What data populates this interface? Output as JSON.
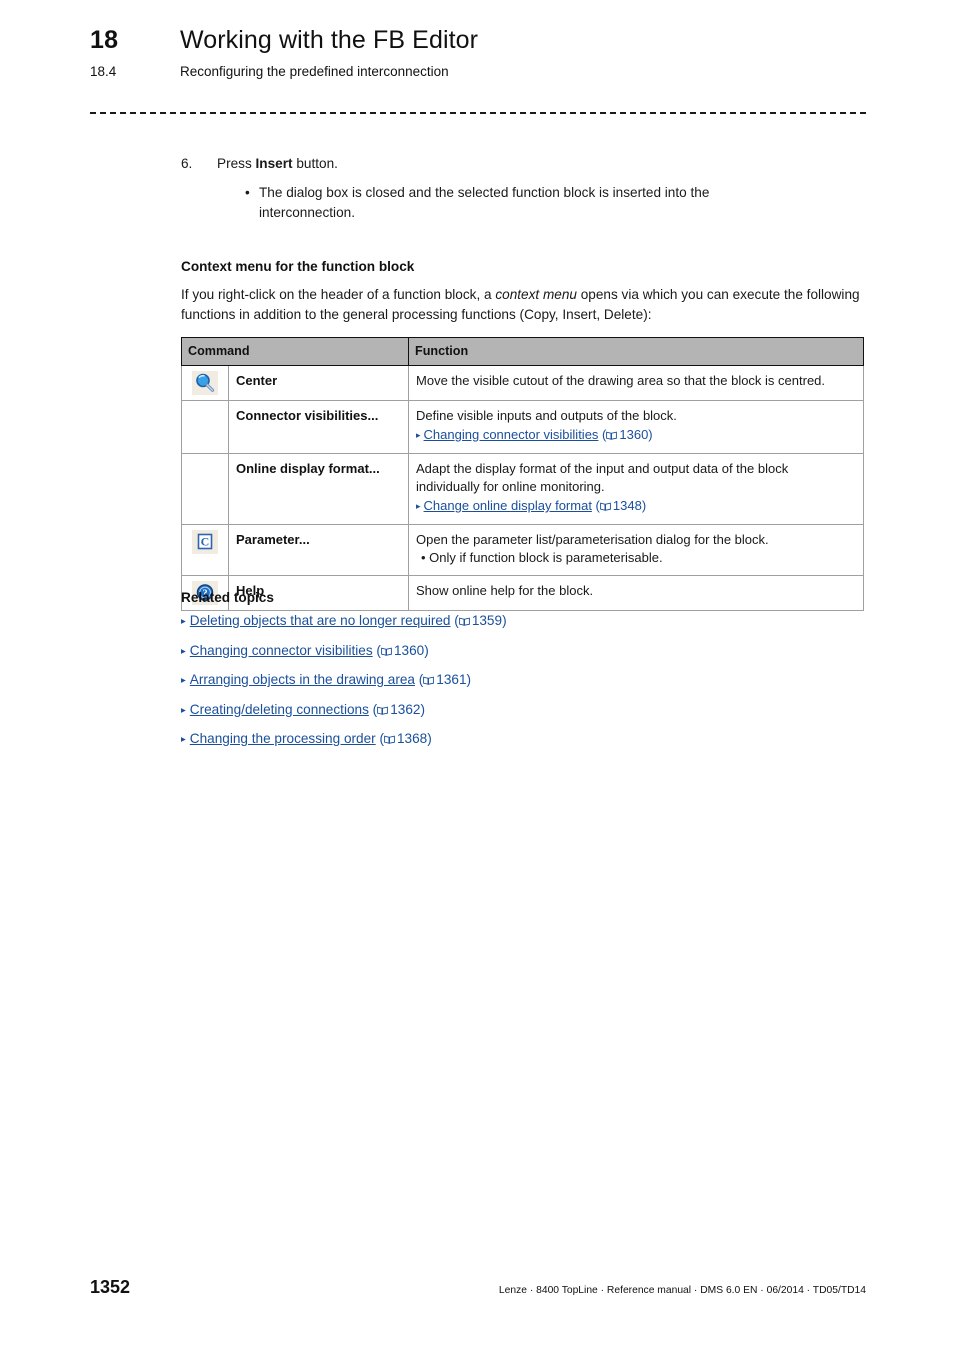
{
  "header": {
    "chapter_number": "18",
    "chapter_title": "Working with the FB Editor",
    "section_number": "18.4",
    "section_title": "Reconfiguring the predefined interconnection"
  },
  "step": {
    "number": "6.",
    "text_before": "Press ",
    "bold_word": "Insert",
    "text_after": " button.",
    "bullet": "•",
    "bullet_text": "The dialog box is closed and the selected function block is inserted into the interconnection."
  },
  "context_section": {
    "heading": "Context menu for the function block",
    "paragraph_part1": "If you right-click on the header of a function block, a ",
    "paragraph_italic": "context menu",
    "paragraph_part2": " opens via which you can execute the following functions in addition to the general processing functions (Copy, Insert, Delete):"
  },
  "table": {
    "columns": [
      "Command",
      "Function"
    ],
    "rows": [
      {
        "icon": "magnifier-icon",
        "command": "Center",
        "function": "Move the visible cutout of the drawing area so that the block is centred.",
        "extra": "",
        "xref": null
      },
      {
        "icon": "",
        "command": "Connector visibilities...",
        "function": "Define visible inputs and outputs of the block.",
        "extra": "",
        "xref": {
          "arrow": "▸",
          "label": "Changing connector visibilities",
          "page": "1360"
        }
      },
      {
        "icon": "",
        "command": "Online display format...",
        "function": "Adapt the display format of the input and output data of the block individually for online monitoring.",
        "extra": "",
        "xref": {
          "arrow": "▸",
          "label": "Change online display format",
          "page": "1348"
        }
      },
      {
        "icon": "parameter-c-icon",
        "command": "Parameter...",
        "function": "Open the parameter list/parameterisation dialog for the block.",
        "extra": "• Only if function block is parameterisable.",
        "xref": null
      },
      {
        "icon": "help-icon",
        "command": "Help",
        "function": "Show online help for the block.",
        "extra": "",
        "xref": null
      }
    ]
  },
  "related": {
    "heading": "Related topics",
    "items": [
      {
        "arrow": "▸",
        "label": "Deleting objects that are no longer required",
        "page": "1359"
      },
      {
        "arrow": "▸",
        "label": "Changing connector visibilities",
        "page": "1360"
      },
      {
        "arrow": "▸",
        "label": "Arranging objects in the drawing area",
        "page": "1361"
      },
      {
        "arrow": "▸",
        "label": "Creating/deleting connections",
        "page": "1362"
      },
      {
        "arrow": "▸",
        "label": "Changing the processing order",
        "page": "1368"
      }
    ]
  },
  "footer": {
    "page_number": "1352",
    "reference": "Lenze · 8400 TopLine · Reference manual · DMS 6.0 EN · 06/2014 · TD05/TD14"
  },
  "colors": {
    "link": "#1a4f9c",
    "table_header_bg": "#b4b4b4",
    "icon_bg": "#f0ece1",
    "text": "#1a1a1a"
  }
}
